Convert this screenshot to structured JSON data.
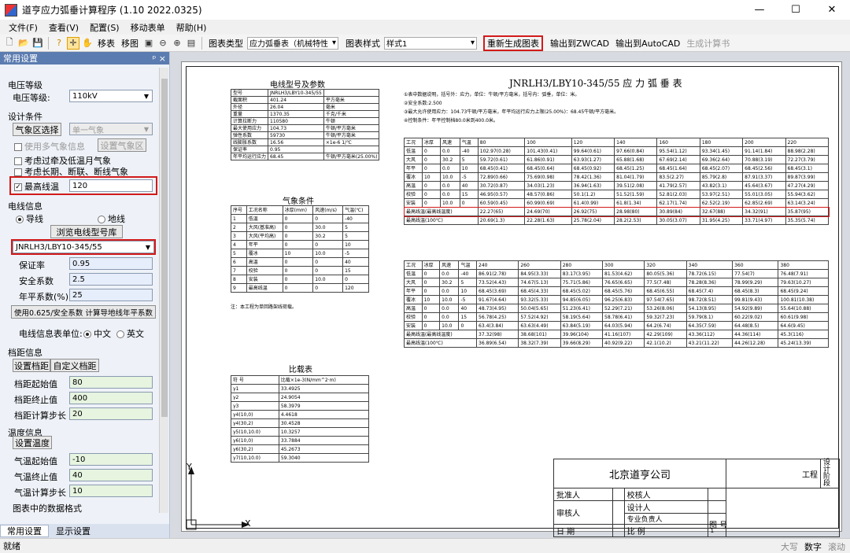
{
  "window": {
    "title": "道亨应力弧垂计算程序 (1.10 2022.0325)",
    "minimize": "—",
    "maximize": "☐",
    "close": "✕"
  },
  "menu": [
    "文件(F)",
    "查看(V)",
    "配置(S)",
    "移动表单",
    "帮助(H)"
  ],
  "toolbar": {
    "move_table": "移表",
    "move_chart": "移图",
    "chart_type_label": "图表类型",
    "chart_type_value": "应力弧垂表（机械特性",
    "chart_style_label": "图表样式",
    "chart_style_value": "样式1",
    "regen": "重新生成图表",
    "export_zwcad": "输出到ZWCAD",
    "export_autocad": "输出到AutoCAD",
    "gen_book": "生成计算书"
  },
  "panel": {
    "title": "常用设置",
    "pin": "ᵖ ×",
    "voltage": {
      "group": "电压等级",
      "label": "电压等级:",
      "value": "110kV"
    },
    "design": {
      "group": "设计条件",
      "zone_btn": "气象区选择",
      "zone_value": "单一气象",
      "use_multi": "使用多气象信息",
      "set_weather": "设置气象区",
      "c1": "考虑过牵及低温月气象",
      "c2": "考虑长期、断联、断线气象",
      "c3": "最高线温",
      "max_temp": "120"
    },
    "wire": {
      "group": "电线信息",
      "r1": "导线",
      "r2": "地线",
      "browse": "浏览电线型号库",
      "model": "JNRLH3/LBY10-345/55",
      "guarantee_label": "保证率",
      "guarantee": "0.95",
      "safety_label": "安全系数",
      "safety": "2.5",
      "avg_label": "年平系数(%)",
      "avg": "25",
      "calc_btn": "使用0.625/安全系数 计算导地线年平系数",
      "unit_label": "电线信息表单位:",
      "u1": "中文",
      "u2": "英文"
    },
    "span": {
      "group": "档距信息",
      "set_btn": "设置档距",
      "custom_btn": "自定义档距",
      "start_label": "档距起始值",
      "start": "80",
      "end_label": "档距终止值",
      "end": "400",
      "step_label": "档距计算步长",
      "step": "20"
    },
    "temp": {
      "group": "温度信息",
      "set_btn": "设置温度",
      "start_label": "气温起始值",
      "start": "-10",
      "end_label": "气温终止值",
      "end": "40",
      "step_label": "气温计算步长",
      "step": "10"
    },
    "fmt": {
      "group": "图表中的数据格式"
    },
    "tabs": [
      "常用设置",
      "显示设置"
    ]
  },
  "drawing": {
    "left": {
      "title1": "电线型号及参数",
      "params": [
        [
          "型号",
          "JNRLH3/LBY10-345/55",
          ""
        ],
        [
          "截面积",
          "401.24",
          "平方毫米"
        ],
        [
          "外径",
          "26.04",
          "毫米"
        ],
        [
          "重量",
          "1370.35",
          "千克/千米"
        ],
        [
          "计算拉断力",
          "110580",
          "牛顿"
        ],
        [
          "最大使用应力",
          "104.73",
          "牛顿/平方毫米"
        ],
        [
          "弹性系数",
          "59730",
          "牛顿/平方毫米"
        ],
        [
          "线膨胀系数",
          "16.56",
          "×1e-6 1/℃"
        ],
        [
          "保证率",
          "0.95",
          ""
        ],
        [
          "年平均运行应力",
          "68.45",
          "牛顿/平方毫米(25.00%)"
        ]
      ],
      "title2": "气象条件",
      "wx_head": [
        "序号",
        "工况名称",
        "冰厚(mm)",
        "风速(m/s)",
        "气温(℃)"
      ],
      "wx": [
        [
          "1",
          "低温",
          "0",
          "0",
          "-40"
        ],
        [
          "2",
          "大风(基准高)",
          "0",
          "30.0",
          "5"
        ],
        [
          "3",
          "大风(平均高)",
          "0",
          "30.2",
          "5"
        ],
        [
          "4",
          "年平",
          "0",
          "0",
          "10"
        ],
        [
          "5",
          "覆冰",
          "10",
          "10.0",
          "-5"
        ],
        [
          "6",
          "高温",
          "0",
          "0",
          "40"
        ],
        [
          "7",
          "校验",
          "0",
          "0",
          "15"
        ],
        [
          "8",
          "安装",
          "0",
          "10.0",
          "0"
        ],
        [
          "9",
          "最高线温",
          "0",
          "0",
          "120"
        ]
      ],
      "note": "注：本工程为单回路架线荷载。",
      "title3": "比载表",
      "ld_head": [
        "符 号",
        "比载×1e-3(N/mm^2·m)"
      ],
      "ld": [
        [
          "γ1",
          "33.4925"
        ],
        [
          "γ2",
          "24.9054"
        ],
        [
          "γ3",
          "58.3979"
        ],
        [
          "γ4(10,0)",
          "4.4618"
        ],
        [
          "γ4(30,2)",
          "30.4528"
        ],
        [
          "γ5(10,10.0)",
          "10.3257"
        ],
        [
          "γ6(10,0)",
          "33.7884"
        ],
        [
          "γ6(30,2)",
          "45.2673"
        ],
        [
          "γ7(10,10.0)",
          "59.3040"
        ]
      ]
    },
    "right": {
      "title": "JNRLH3/LBY10-345/55 应 力 弧 垂 表",
      "notes": [
        "①表中数据说明，括号外：应力，单位：牛顿/平方毫米，括号内：弧垂，单位：米。",
        "②安全系数:2.500",
        "③最大允许使用应力：104.73牛顿/平方毫米，年平均运行应力上限(25.00%)：68.45牛顿/平方毫米。",
        "④控制条件：年平控制档80.0米到400.0米。"
      ],
      "head": [
        "工况",
        "冰厚",
        "风速",
        "气温"
      ],
      "cond": [
        [
          "低温",
          "0",
          "0.0",
          "-40"
        ],
        [
          "大风",
          "0",
          "30.2",
          "5"
        ],
        [
          "年平",
          "0",
          "0.0",
          "10"
        ],
        [
          "覆冰",
          "10",
          "10.0",
          "-5"
        ],
        [
          "高温",
          "0",
          "0.0",
          "40"
        ],
        [
          "校验",
          "0",
          "0.0",
          "15"
        ],
        [
          "安装",
          "0",
          "10.0",
          "0"
        ]
      ],
      "t1_spans": [
        "80",
        "100",
        "120",
        "140",
        "160",
        "180",
        "200",
        "220"
      ],
      "t1": [
        [
          "102.97(0.28)",
          "101.43(0.41)",
          "99.64(0.61)",
          "97.66(0.84)",
          "95.54(1.12)",
          "93.34(1.45)",
          "91.14(1.84)",
          "88.98(2.28)"
        ],
        [
          "59.72(0.61)",
          "61.86(0.91)",
          "63.93(1.27)",
          "65.88(1.68)",
          "67.69(2.14)",
          "69.36(2.64)",
          "70.88(3.19)",
          "72.27(3.79)"
        ],
        [
          "68.45(0.41)",
          "68.45(0.64)",
          "68.45(0.92)",
          "68.45(1.25)",
          "68.45(1.64)",
          "68.45(2.07)",
          "68.45(2.56)",
          "68.45(3.1)"
        ],
        [
          "72.89(0.66)",
          "75.69(0.98)",
          "78.42(1.36)",
          "81.04(1.79)",
          "83.5(2.27)",
          "85.79(2.8)",
          "87.91(3.37)",
          "89.87(3.99)"
        ],
        [
          "30.72(0.87)",
          "34.03(1.23)",
          "36.94(1.63)",
          "39.51(2.08)",
          "41.79(2.57)",
          "43.82(3.1)",
          "45.64(3.67)",
          "47.27(4.29)"
        ],
        [
          "46.95(0.57)",
          "48.57(0.86)",
          "50.1(1.2)",
          "51.52(1.59)",
          "52.81(2.03)",
          "53.97(2.51)",
          "55.01(3.05)",
          "55.94(3.62)"
        ],
        [
          "60.59(0.45)",
          "60.99(0.69)",
          "61.4(0.99)",
          "61.8(1.34)",
          "62.17(1.74)",
          "62.52(2.19)",
          "62.85(2.69)",
          "63.14(3.24)"
        ]
      ],
      "t1_hl_label": "最高线温(最高线温度)",
      "t1_hl": [
        "22.27(65)",
        "24.69(70)",
        "26.92(75)",
        "28.98(80)",
        "30.89(84)",
        "32.67(88)",
        "34.32(91)",
        "35.87(95)"
      ],
      "t1_last_label": "最高线温(100℃)",
      "t1_last": [
        "20.69(1.3)",
        "22.28(1.63)",
        "25.78(2.04)",
        "28.2(2.53)",
        "30.05(3.07)",
        "31.95(4.25)",
        "33.71(4.97)",
        "35.35(5.74)"
      ],
      "t2_spans": [
        "240",
        "260",
        "280",
        "300",
        "320",
        "340",
        "360",
        "380"
      ],
      "t2": [
        [
          "86.91(2.78)",
          "84.95(3.33)",
          "83.17(3.95)",
          "81.53(4.62)",
          "80.05(5.36)",
          "78.72(6.15)",
          "77.54(7)",
          "76.48(7.91)"
        ],
        [
          "73.52(4.43)",
          "74.67(5.13)",
          "75.71(5.86)",
          "76.65(6.65)",
          "77.5(7.48)",
          "78.28(8.36)",
          "78.99(9.29)",
          "79.63(10.27)"
        ],
        [
          "68.45(3.69)",
          "68.45(4.33)",
          "68.45(5.02)",
          "68.45(5.76)",
          "68.45(6.55)",
          "68.45(7.4)",
          "68.45(8.3)",
          "68.45(9.24)"
        ],
        [
          "91.67(4.64)",
          "93.32(5.33)",
          "94.85(6.05)",
          "96.25(6.83)",
          "97.54(7.65)",
          "98.72(8.51)",
          "99.81(9.43)",
          "100.81(10.38)"
        ],
        [
          "48.73(4.95)",
          "50.04(5.65)",
          "51.23(6.41)",
          "52.29(7.21)",
          "53.26(8.06)",
          "54.13(8.95)",
          "54.92(9.89)",
          "55.64(10.88)"
        ],
        [
          "56.78(4.25)",
          "57.52(4.92)",
          "58.19(5.64)",
          "58.78(6.41)",
          "59.32(7.23)",
          "59.79(8.1)",
          "60.22(9.02)",
          "60.61(9.98)"
        ],
        [
          "63.4(3.84)",
          "63.63(4.49)",
          "63.84(5.19)",
          "64.03(5.94)",
          "64.2(6.74)",
          "64.35(7.59)",
          "64.48(8.5)",
          "64.6(9.45)"
        ]
      ],
      "t2_hl": [
        "37.32(98)",
        "38.68(101)",
        "39.96(104)",
        "41.16(107)",
        "42.29(109)",
        "43.36(112)",
        "44.36(114)",
        "45.3(116)"
      ],
      "t2_last": [
        "36.89(6.54)",
        "38.32(7.39)",
        "39.66(8.29)",
        "40.92(9.22)",
        "42.1(10.2)",
        "43.21(11.22)",
        "44.26(12.28)",
        "45.24(13.39)"
      ]
    },
    "titleblock": {
      "company": "北京道亨公司",
      "project": "工程",
      "stage": "设计阶段",
      "approve": "批准人",
      "review": "审核人",
      "check": "校核人",
      "design": "设计人",
      "owner": "专业负责人",
      "date": "日 期",
      "scale": "比 例",
      "scale_val": "1",
      "drawno": "图 号"
    },
    "axis": {
      "x": "X",
      "y": "Y"
    }
  },
  "status": {
    "left": "就绪",
    "caps": "大写",
    "num": "数字",
    "scroll": "滚动"
  }
}
